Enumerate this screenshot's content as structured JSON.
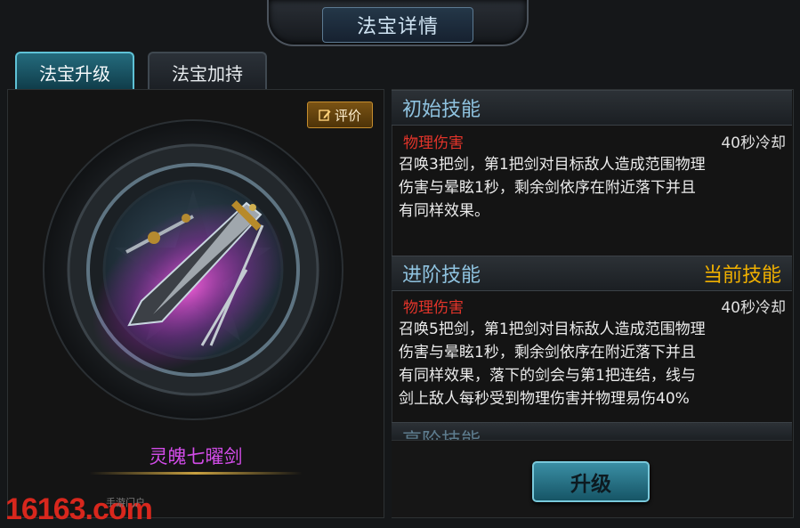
{
  "header": {
    "title": "法宝详情"
  },
  "tabs": [
    {
      "label": "法宝升级",
      "active": true
    },
    {
      "label": "法宝加持",
      "active": false
    }
  ],
  "left": {
    "rate_button": "评价",
    "item_name": "灵魄七曜剑"
  },
  "sections": [
    {
      "heading": "初始技能",
      "current_label": "",
      "skill_type": "物理伤害",
      "cooldown": "40秒冷却",
      "lines": [
        "召唤3把剑，第1把剑对目标敌人造成范围物理",
        "伤害与晕眩1秒，剩余剑依序在附近落下并且",
        "有同样效果。"
      ]
    },
    {
      "heading": "进阶技能",
      "current_label": "当前技能",
      "skill_type": "物理伤害",
      "cooldown": "40秒冷却",
      "lines": [
        "召唤5把剑，第1把剑对目标敌人造成范围物理",
        "伤害与晕眩1秒，剩余剑依序在附近落下并且",
        "有同样效果，落下的剑会与第1把连结，线与",
        "剑上敌人每秒受到物理伤害并物理易伤40%"
      ]
    },
    {
      "heading": "高阶技能"
    }
  ],
  "upgrade_button": "升级",
  "watermark": {
    "main": "16163.com",
    "sub": "手游门户"
  },
  "colors": {
    "accent": "#5fc2d6",
    "skill_type": "#e2342a",
    "current": "#f0b000",
    "item_name": "#d24ce8"
  }
}
